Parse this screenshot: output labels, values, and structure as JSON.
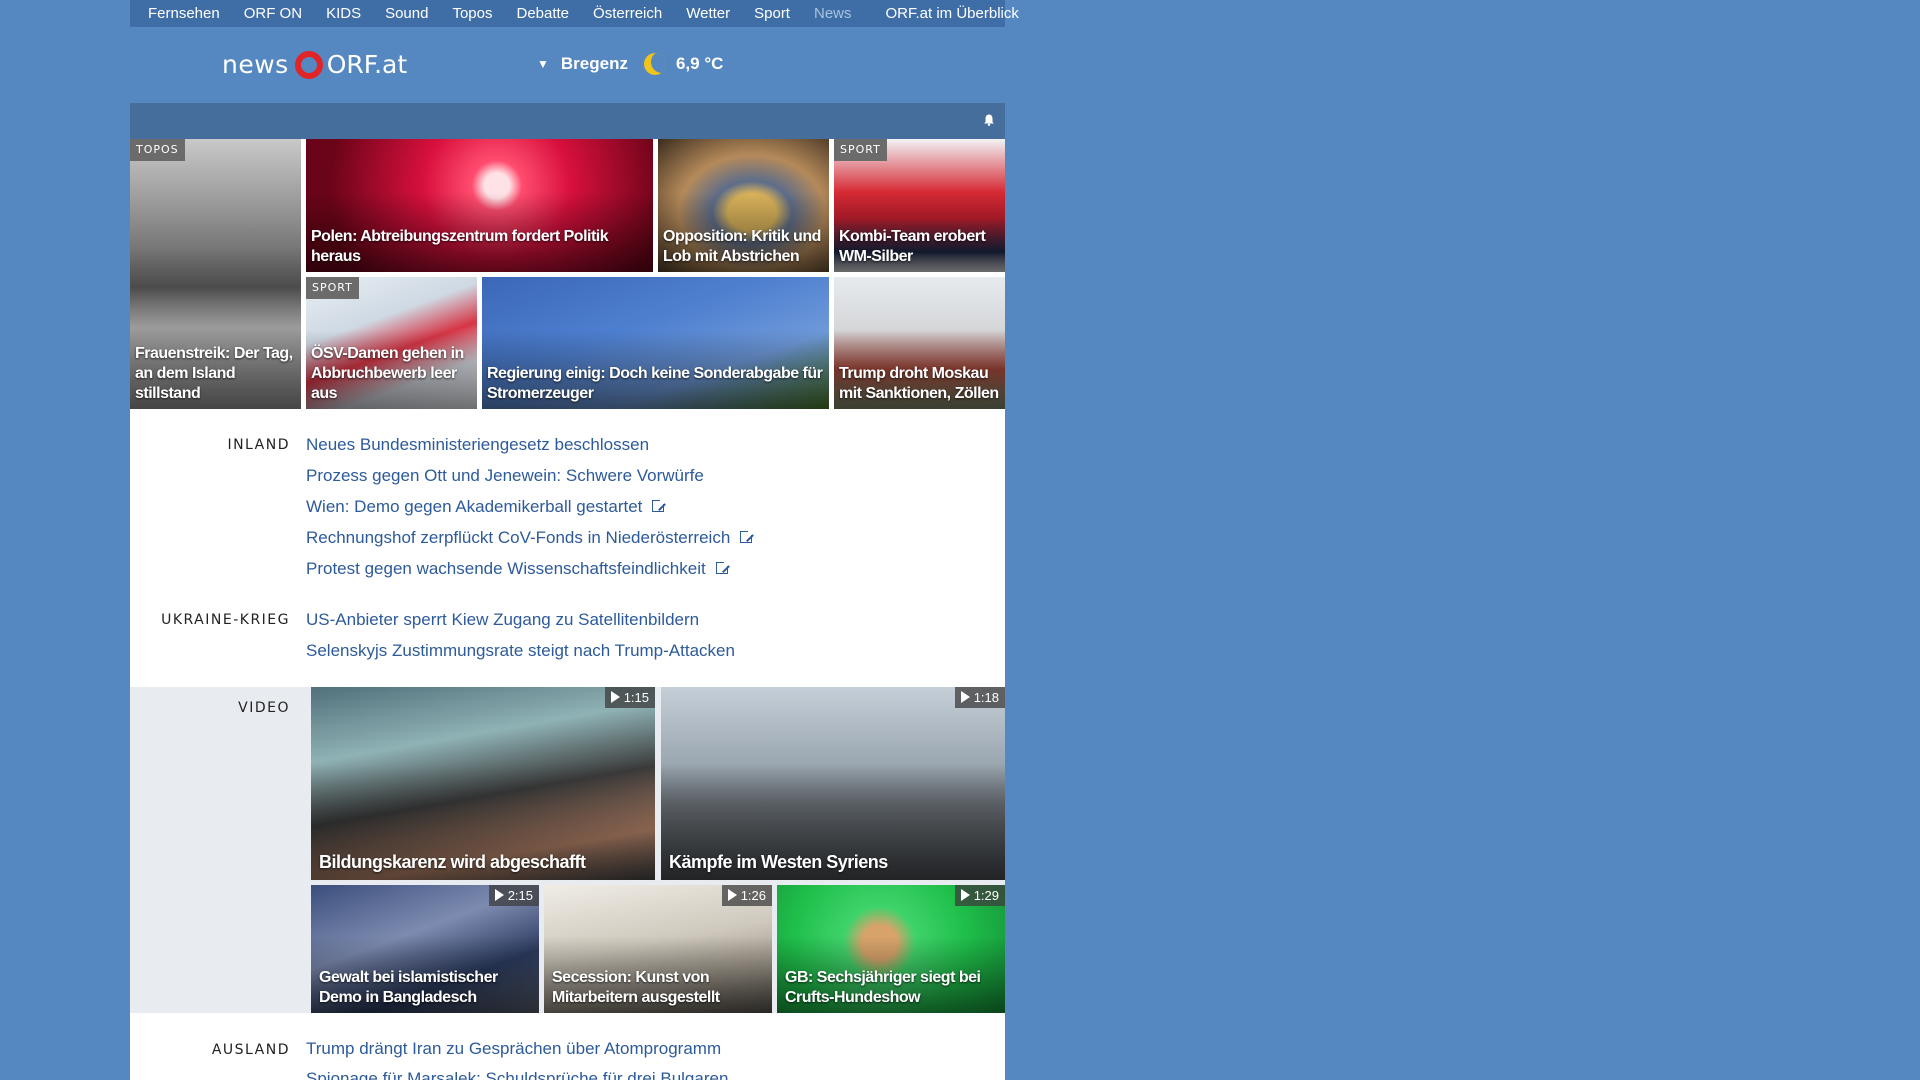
{
  "nav": {
    "items": [
      "Fernsehen",
      "ORF ON",
      "KIDS",
      "Sound",
      "Topos",
      "Debatte",
      "Österreich",
      "Wetter",
      "Sport",
      "News"
    ],
    "active": "News",
    "overview": "ORF.at im Überblick"
  },
  "brand": {
    "news": "news",
    "orf": "ORF.at"
  },
  "weather": {
    "city": "Bregenz",
    "temp": "6,9 °C",
    "icon": "moon-icon"
  },
  "tiles": {
    "topos": {
      "tag": "TOPOS",
      "caption": "Frauenstreik: Der Tag, an dem Island stillstand"
    },
    "polen": {
      "caption": "Polen: Abtreibungszentrum fordert Politik heraus"
    },
    "opposition": {
      "caption": "Opposition: Kritik und Lob mit Abstrichen"
    },
    "kombi": {
      "tag": "SPORT",
      "caption": "Kombi-Team erobert WM-Silber"
    },
    "oesv": {
      "tag": "SPORT",
      "caption": "ÖSV-Damen gehen in Abbruchbewerb leer aus"
    },
    "regierung": {
      "caption": "Regierung einig: Doch keine Sonderabgabe für Stromerzeuger"
    },
    "trump": {
      "caption": "Trump droht Moskau mit Sanktionen, Zöllen"
    }
  },
  "inland": {
    "label": "INLAND",
    "links": [
      "Neues Bundesministeriengesetz beschlossen",
      "Prozess gegen Ott und Jenewein: Schwere Vorwürfe",
      "Wien: Demo gegen Akademikerball gestartet",
      "Rechnungshof zerpflückt CoV-Fonds in Niederösterreich",
      "Protest gegen wachsende Wissenschaftsfeindlichkeit"
    ]
  },
  "ukraine": {
    "label": "UKRAINE-KRIEG",
    "links": [
      "US-Anbieter sperrt Kiew Zugang zu Satellitenbildern",
      "Selenskyjs Zustimmungsrate steigt nach Trump-Attacken"
    ]
  },
  "video": {
    "label": "VIDEO",
    "items": [
      {
        "caption": "Bildungskarenz wird abgeschafft",
        "duration": "1:15"
      },
      {
        "caption": "Kämpfe im Westen Syriens",
        "duration": "1:18"
      },
      {
        "caption": "Gewalt bei islamistischer Demo in Bangladesch",
        "duration": "2:15"
      },
      {
        "caption": "Secession: Kunst von Mitarbeitern ausgestellt",
        "duration": "1:26"
      },
      {
        "caption": "GB: Sechsjähriger siegt bei Crufts-Hundeshow",
        "duration": "1:29"
      }
    ]
  },
  "ausland": {
    "label": "AUSLAND",
    "links": [
      "Trump drängt Iran zu Gesprächen über Atomprogramm",
      "Spionage für Marsalek: Schuldsprüche für drei Bulgaren"
    ]
  }
}
